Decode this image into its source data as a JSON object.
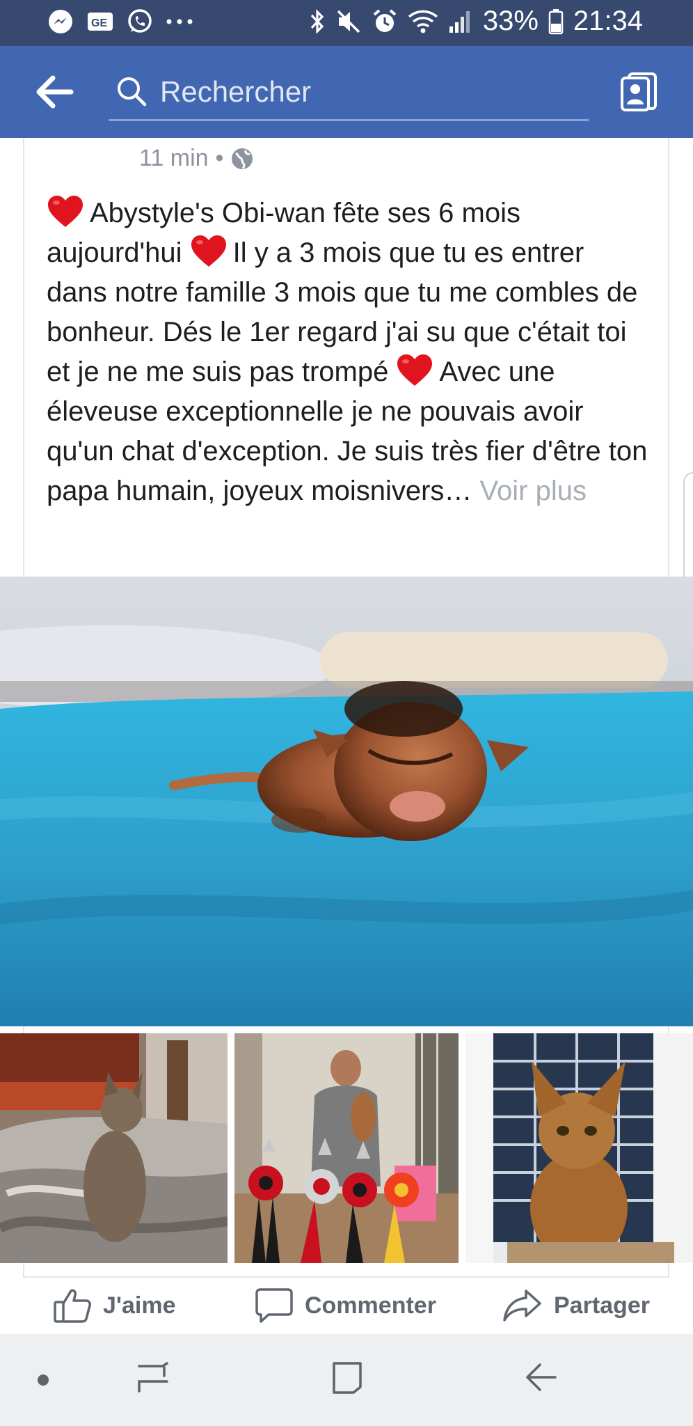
{
  "status_bar": {
    "icons_left": [
      "messenger-icon",
      "news-icon",
      "whatsapp-icon",
      "more-dots-icon"
    ],
    "icons_right": [
      "bluetooth-icon",
      "mute-icon",
      "alarm-icon",
      "wifi-icon",
      "signal-icon"
    ],
    "battery": "33%",
    "time": "21:34"
  },
  "header": {
    "search_placeholder": "Rechercher",
    "accent": "#4267b2"
  },
  "post": {
    "time": "11 min",
    "separator": "•",
    "text_parts": [
      "Abystyle's Obi-wan fête ses 6 mois aujourd'hui ",
      "Il y a 3 mois que tu es entrer dans notre famille 3 mois que tu me combles de bonheur. Dés le 1er regard j'ai su que c'était toi et je ne me suis pas trompé ",
      "Avec une éleveuse exceptionnelle je ne pouvais avoir qu'un chat d'exception. Je suis très fier d'être ton papa humain, joyeux moisnivers"
    ],
    "ellipsis": "…",
    "see_more": "Voir plus"
  },
  "actions": {
    "like": "J'aime",
    "comment": "Commenter",
    "share": "Partager"
  }
}
